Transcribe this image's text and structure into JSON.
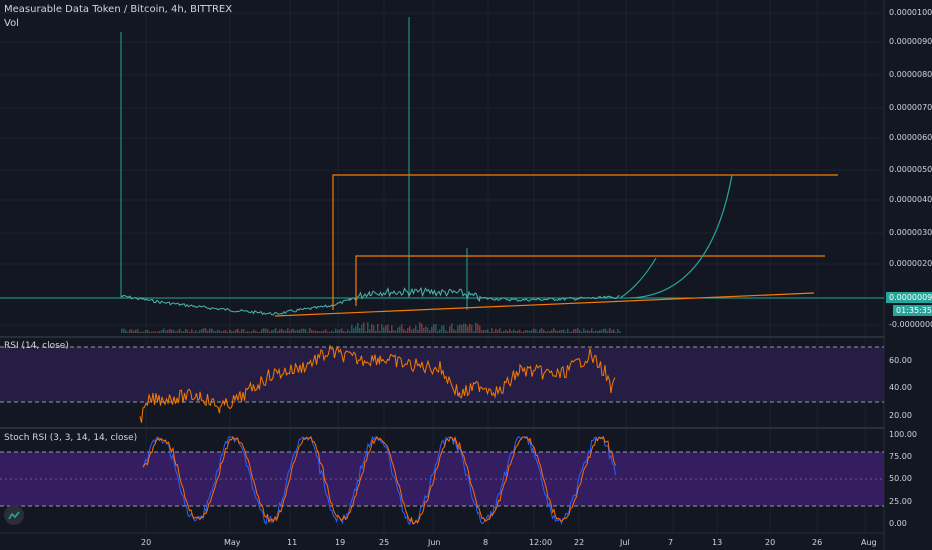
{
  "header": {
    "title": "Measurable Data Token / Bitcoin, 4h, BITTREX",
    "vol_label": "Vol"
  },
  "price_axis": {
    "ticks": [
      "0.00001000",
      "0.00000900",
      "0.00000800",
      "0.00000700",
      "0.00000600",
      "0.00000500",
      "0.00000400",
      "0.00000300",
      "0.00000200",
      "-0.00000000"
    ],
    "last_price": "0.00000090",
    "countdown": "01:35:35"
  },
  "rsi_panel": {
    "label": "RSI (14, close)",
    "ticks": [
      "60.00",
      "40.00",
      "20.00"
    ]
  },
  "stoch_panel": {
    "label": "Stoch RSI (3, 3, 14, 14, close)",
    "ticks": [
      "100.00",
      "75.00",
      "50.00",
      "25.00",
      "0.00"
    ]
  },
  "time_axis": {
    "ticks": [
      "20",
      "May",
      "11",
      "19",
      "25",
      "Jun",
      "8",
      "12:00",
      "22",
      "Jul",
      "7",
      "13",
      "20",
      "26",
      "Aug"
    ]
  },
  "colors": {
    "background": "#131722",
    "grid": "#1e222d",
    "teal": "#26a69a",
    "orange": "#f57c00",
    "rsi_band": "#2a1e4a",
    "stoch_band": "#3b1f6b",
    "k_line": "#2962ff",
    "d_line": "#ff6d00"
  },
  "chart_data": {
    "type": "line",
    "title": "Measurable Data Token / Bitcoin, 4h, BITTREX",
    "ylim": [
      0,
      1e-05
    ],
    "price_line": {
      "x": [
        "Apr 20",
        "Apr 25",
        "May 1",
        "May 8",
        "May 15",
        "May 20",
        "May 25",
        "Jun 1",
        "Jun 8",
        "Jun 15",
        "Jun 22",
        "Jun 27"
      ],
      "y": [
        9e-07,
        6e-07,
        5e-07,
        4e-07,
        5e-07,
        7e-07,
        1.2e-06,
        1.2e-06,
        8e-07,
        9e-07,
        9e-07,
        9e-07
      ]
    },
    "spikes": [
      {
        "x": "Apr 20",
        "y": 9.5e-06
      },
      {
        "x": "May 27",
        "y": 1e-05
      },
      {
        "x": "Jun 6",
        "y": 2.5e-06
      }
    ],
    "horizontal_levels": [
      5e-06,
      2.4e-06
    ],
    "rsi_levels": [
      70,
      30
    ],
    "stoch_levels": [
      80,
      20
    ]
  }
}
